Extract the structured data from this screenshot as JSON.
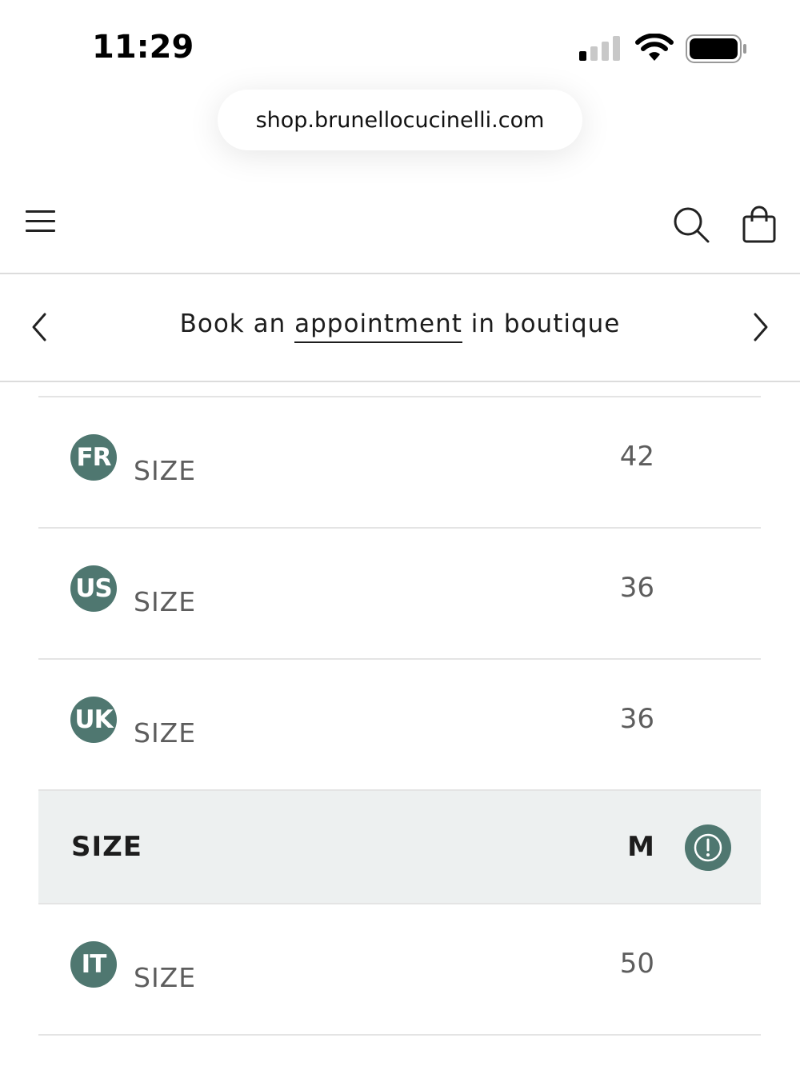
{
  "status_bar": {
    "time": "11:29"
  },
  "browser": {
    "url": "shop.brunellocucinelli.com"
  },
  "banner": {
    "text_before": "Book an ",
    "link_text": "appointment",
    "text_after": " in boutique"
  },
  "size_rows": [
    {
      "flag": "FR",
      "label": "SIZE",
      "value": "42"
    },
    {
      "flag": "US",
      "label": "SIZE",
      "value": "36"
    },
    {
      "flag": "UK",
      "label": "SIZE",
      "value": "36"
    },
    {
      "flag": "",
      "label": "SIZE",
      "value": "M",
      "highlighted": true
    },
    {
      "flag": "IT",
      "label": "SIZE",
      "value": "50"
    }
  ],
  "colors": {
    "accent": "#4f7770",
    "highlight_bg": "#edf0f0",
    "muted_text": "#5d5d5d"
  },
  "icons": {
    "menu": "menu-icon",
    "search": "search-icon",
    "bag": "shopping-bag-icon",
    "prev": "chevron-left-icon",
    "next": "chevron-right-icon",
    "info": "info-icon"
  }
}
